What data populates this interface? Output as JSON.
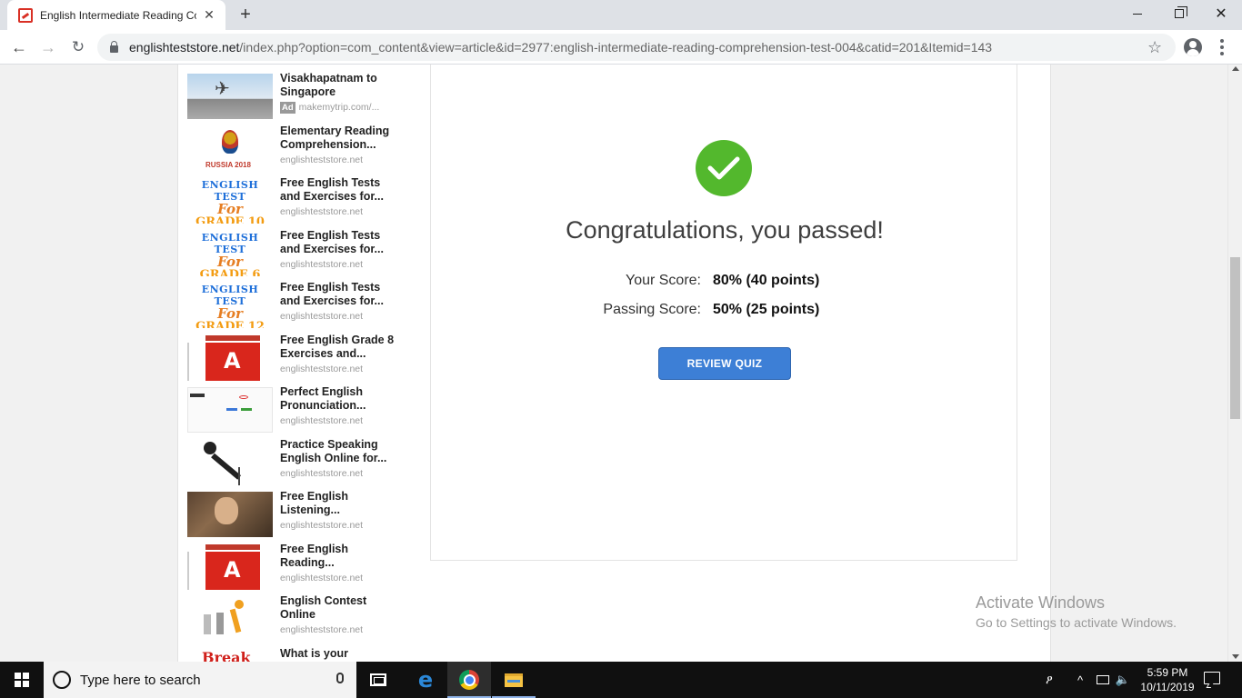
{
  "browser": {
    "tab_title": "English Intermediate Reading Co",
    "tab_close": "✕",
    "new_tab": "+",
    "url_host": "englishteststore.net",
    "url_path": "/index.php?option=com_content&view=article&id=2977:english-intermediate-reading-comprehension-test-004&catid=201&Itemid=143",
    "close_glyph": "✕",
    "star_glyph": "☆",
    "back_glyph": "←",
    "forward_glyph": "→",
    "reload_glyph": "↻"
  },
  "sidebar_ads": [
    {
      "title": "Visakhapatnam to Singapore",
      "source": "makemytrip.com/...",
      "ad_badge": "Ad",
      "thumb": "plane"
    },
    {
      "title": "Elementary Reading Comprehension...",
      "source": "englishteststore.net",
      "thumb": "fifa",
      "thumb_text": "RUSSIA 2018"
    },
    {
      "title": "Free English Tests and Exercises for...",
      "source": "englishteststore.net",
      "thumb": "grade",
      "thumb_l1": "ENGLISH TEST",
      "thumb_l2": "For",
      "thumb_l3": "GRADE 10"
    },
    {
      "title": "Free English Tests and Exercises for...",
      "source": "englishteststore.net",
      "thumb": "grade",
      "thumb_l1": "ENGLISH TEST",
      "thumb_l2": "For",
      "thumb_l3": "GRADE 6"
    },
    {
      "title": "Free English Tests and Exercises for...",
      "source": "englishteststore.net",
      "thumb": "grade",
      "thumb_l1": "ENGLISH TEST",
      "thumb_l2": "For",
      "thumb_l3": "GRADE 12"
    },
    {
      "title": "Free English Grade 8 Exercises and...",
      "source": "englishteststore.net",
      "thumb": "pdf"
    },
    {
      "title": "Perfect English Pronunciation...",
      "source": "englishteststore.net",
      "thumb": "screen"
    },
    {
      "title": "Practice Speaking English Online for...",
      "source": "englishteststore.net",
      "thumb": "mic"
    },
    {
      "title": "Free English Listening...",
      "source": "englishteststore.net",
      "thumb": "listen"
    },
    {
      "title": "Free English Reading...",
      "source": "englishteststore.net",
      "thumb": "pdf"
    },
    {
      "title": "English Contest Online",
      "source": "englishteststore.net",
      "thumb": "contest"
    },
    {
      "title": "What is your",
      "source": "",
      "thumb": "break",
      "thumb_text": "Break"
    }
  ],
  "result": {
    "heading": "Congratulations, you passed!",
    "your_score_label": "Your Score:",
    "your_score_value": "80% (40 points)",
    "passing_score_label": "Passing Score:",
    "passing_score_value": "50% (25 points)",
    "review_button": "REVIEW QUIZ",
    "success_color": "#53b82d",
    "button_color": "#3d7fd6"
  },
  "watermark": {
    "line1": "Activate Windows",
    "line2": "Go to Settings to activate Windows."
  },
  "taskbar": {
    "search_placeholder": "Type here to search",
    "time": "5:59 PM",
    "date": "10/11/2019",
    "tray_person": "ዖ",
    "tray_chevron": "^",
    "tray_speaker": "🔈"
  }
}
